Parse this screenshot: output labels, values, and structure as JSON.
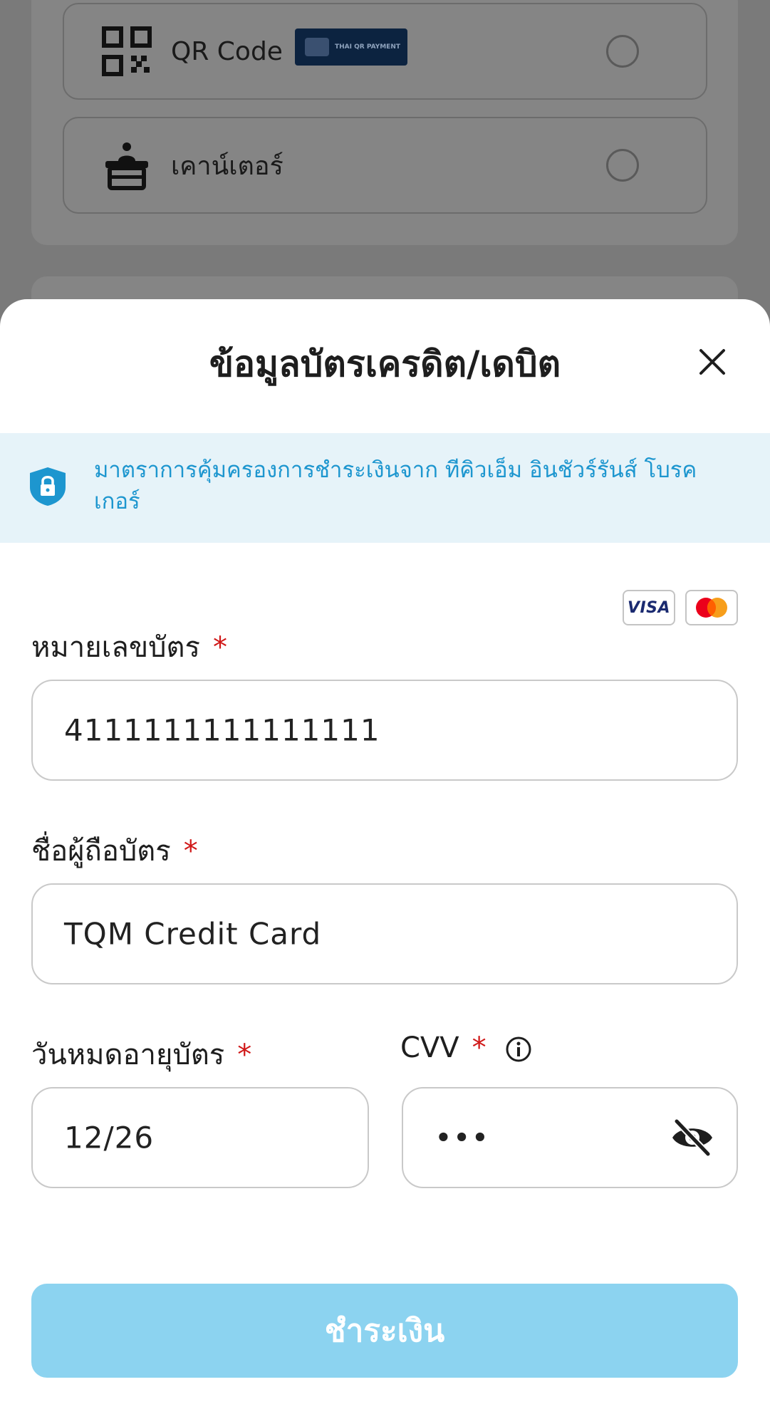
{
  "payment_options": [
    {
      "label": "QR Code",
      "badge_text": "THAI QR PAYMENT",
      "icon": "qr-code-icon"
    },
    {
      "label": "เคาน์เตอร์",
      "icon": "counter-icon"
    }
  ],
  "sheet": {
    "title": "ข้อมูลบัตรเครดิต/เดบิต",
    "notice": "มาตราการคุ้มครองการชำระเงินจาก ทีคิวเอ็ม อินชัวร์รันส์ โบรคเกอร์",
    "card_brands": [
      "VISA",
      "Mastercard"
    ]
  },
  "form": {
    "card_number_label": "หมายเลขบัตร",
    "card_number_value": "4111111111111111",
    "holder_label": "ชื่อผู้ถือบัตร",
    "holder_value": "TQM Credit Card",
    "expiry_label": "วันหมดอายุบัตร",
    "expiry_value": "12/26",
    "cvv_label": "CVV",
    "cvv_value": "•••",
    "required_mark": "*"
  },
  "submit_label": "ชำระเงิน",
  "colors": {
    "accent": "#1d96cf",
    "notice_bg": "#e6f3f9",
    "button_disabled": "#8cd3f0",
    "required": "#d01818"
  }
}
